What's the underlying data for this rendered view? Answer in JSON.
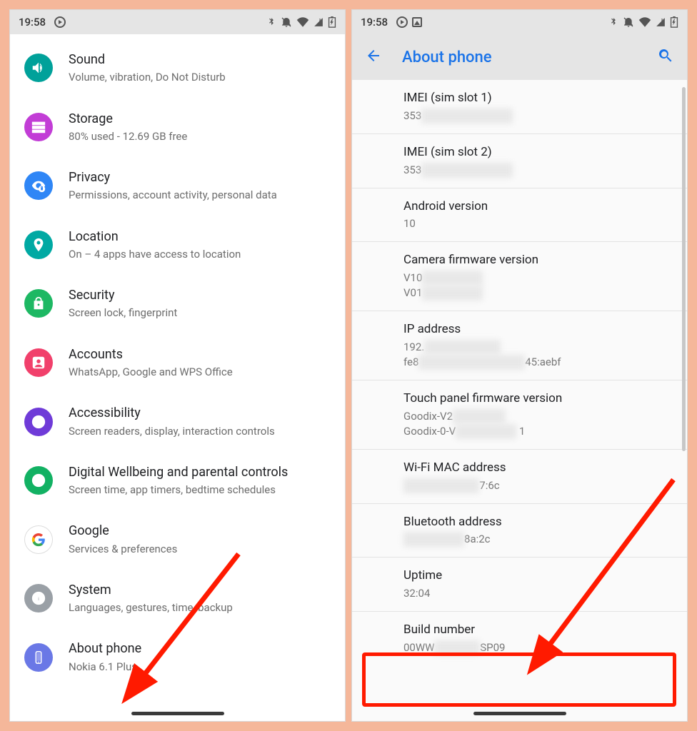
{
  "statusbar": {
    "time": "19:58"
  },
  "left": {
    "items": [
      {
        "icon": "sound",
        "color": "#00a19a",
        "title": "Sound",
        "sub": "Volume, vibration, Do Not Disturb"
      },
      {
        "icon": "storage",
        "color": "#c23dd6",
        "title": "Storage",
        "sub": "80% used - 12.69 GB free"
      },
      {
        "icon": "privacy",
        "color": "#2f86f6",
        "title": "Privacy",
        "sub": "Permissions, account activity, personal data"
      },
      {
        "icon": "location",
        "color": "#00a9a3",
        "title": "Location",
        "sub": "On – 4 apps have access to location"
      },
      {
        "icon": "security",
        "color": "#1db863",
        "title": "Security",
        "sub": "Screen lock, fingerprint"
      },
      {
        "icon": "accounts",
        "color": "#f1406b",
        "title": "Accounts",
        "sub": "WhatsApp, Google and WPS Office"
      },
      {
        "icon": "access",
        "color": "#6f3bd8",
        "title": "Accessibility",
        "sub": "Screen readers, display, interaction controls"
      },
      {
        "icon": "wellbeing",
        "color": "#12b163",
        "title": "Digital Wellbeing and parental controls",
        "sub": "Screen time, app timers, bedtime schedules"
      },
      {
        "icon": "google",
        "color": "#ffffff",
        "title": "Google",
        "sub": "Services & preferences"
      },
      {
        "icon": "system",
        "color": "#9aa0a6",
        "title": "System",
        "sub": "Languages, gestures, time, backup"
      },
      {
        "icon": "about",
        "color": "#6a78e6",
        "title": "About phone",
        "sub": "Nokia 6.1 Plus"
      }
    ]
  },
  "right": {
    "header": "About phone",
    "rows": [
      {
        "title": "IMEI (sim slot 1)",
        "sub_prefix": "353",
        "sub_blur": "████████████"
      },
      {
        "title": "IMEI (sim slot 2)",
        "sub_prefix": "353",
        "sub_blur": "████████████"
      },
      {
        "title": "Android version",
        "sub_prefix": "10",
        "sub_blur": ""
      },
      {
        "title": "Camera firmware version",
        "lines": [
          {
            "prefix": "V10",
            "blur": "████████"
          },
          {
            "prefix": "V01",
            "blur": "████████"
          }
        ]
      },
      {
        "title": "IP address",
        "lines": [
          {
            "prefix": "192.",
            "blur": "██████████"
          },
          {
            "prefix": "fe8",
            "blur": "██████████████",
            "suffix": "45:aebf"
          }
        ]
      },
      {
        "title": "Touch panel firmware version",
        "lines": [
          {
            "prefix": "Goodix-V2",
            "blur": "███████"
          },
          {
            "prefix": "Goodix-0-V",
            "blur": "████████",
            "suffix": " 1"
          }
        ]
      },
      {
        "title": "Wi-Fi MAC address",
        "sub_prefix": "",
        "sub_blur": "██████████",
        "sub_suffix": "7:6c"
      },
      {
        "title": "Bluetooth address",
        "sub_prefix": "",
        "sub_blur": "████████",
        "sub_suffix": "8a:2c"
      },
      {
        "title": "Uptime",
        "sub_prefix": "32:04",
        "sub_blur": ""
      },
      {
        "title": "Build number",
        "sub_prefix": "00WW",
        "sub_blur": "██████",
        "sub_suffix": "SP09",
        "highlight": true
      }
    ]
  }
}
